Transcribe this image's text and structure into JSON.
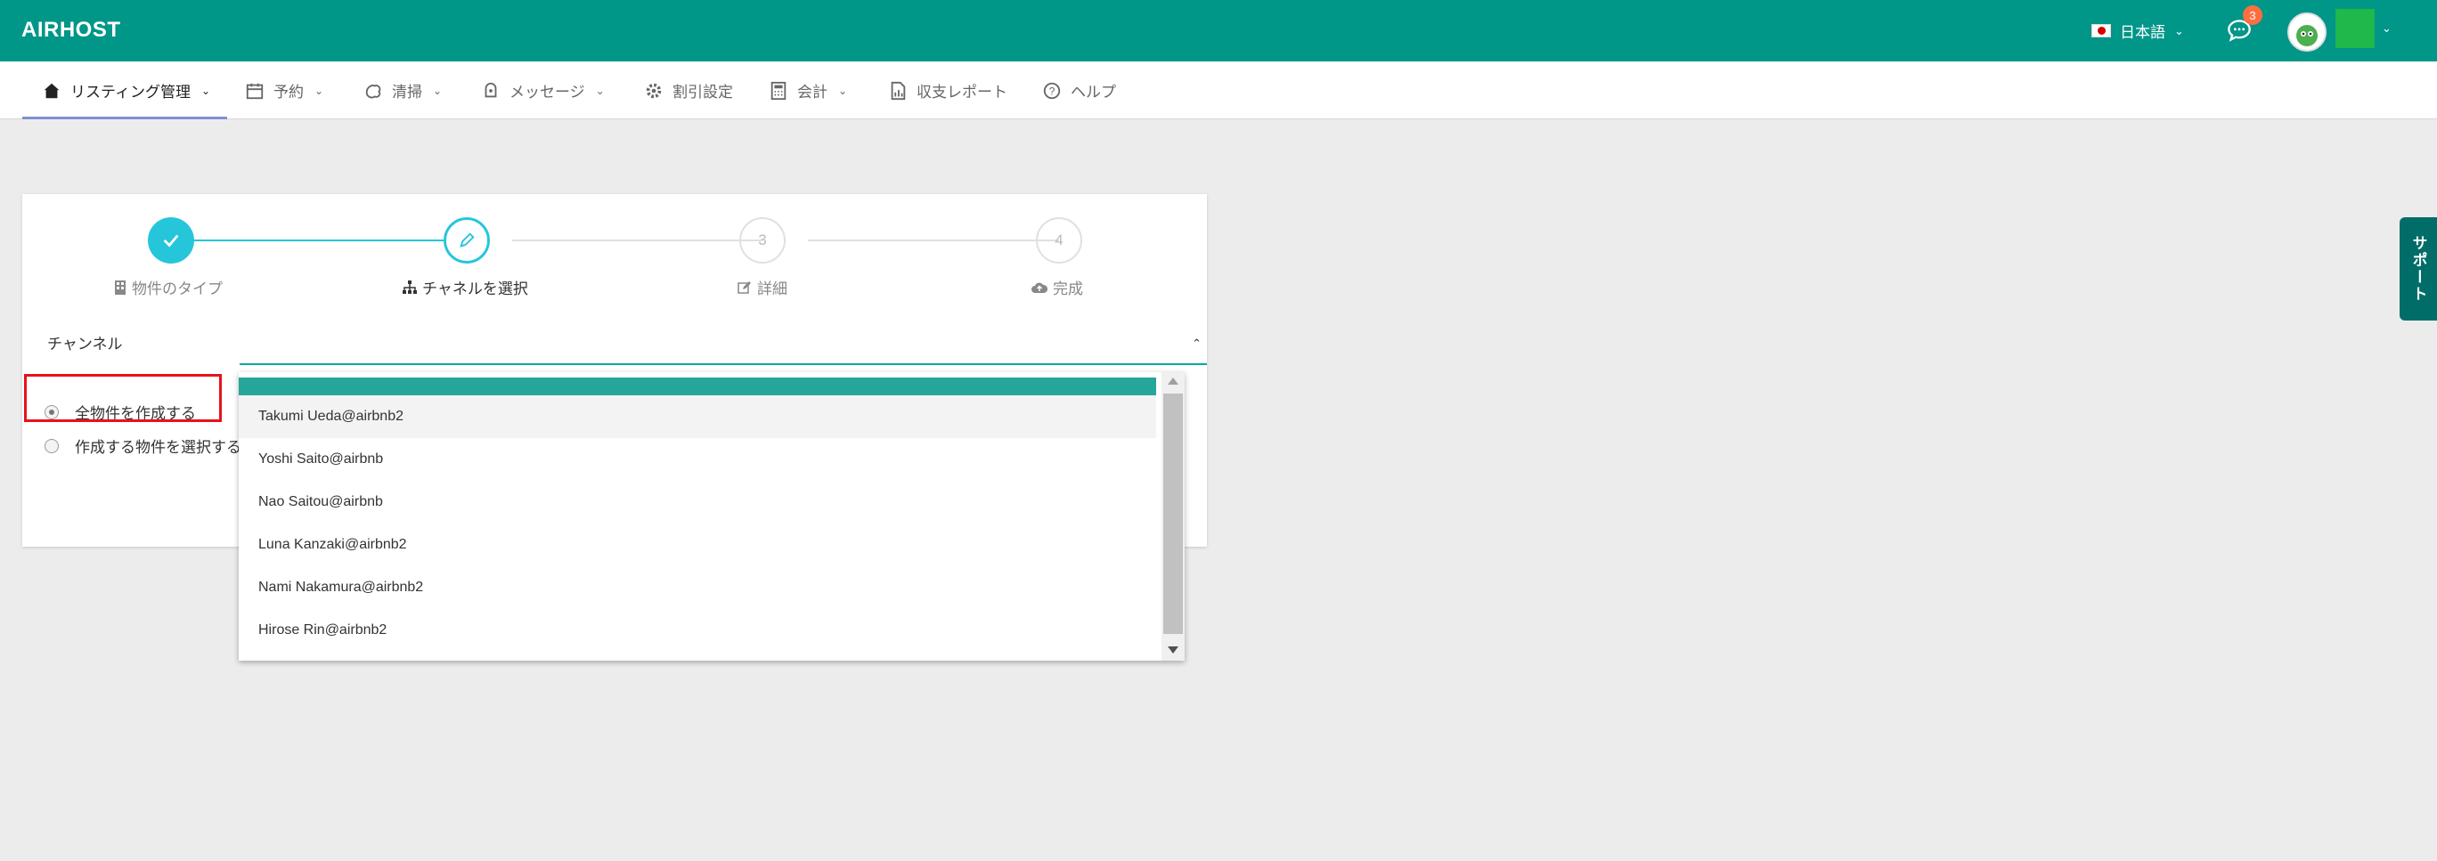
{
  "header": {
    "logo": "AIRHOST",
    "language": "日本語",
    "notification_count": "3"
  },
  "nav": {
    "items": [
      {
        "label": "リスティング管理",
        "icon": "home-icon",
        "has_dropdown": true,
        "active": true
      },
      {
        "label": "予約",
        "icon": "calendar-icon",
        "has_dropdown": true
      },
      {
        "label": "清掃",
        "icon": "cleaning-icon",
        "has_dropdown": true
      },
      {
        "label": "メッセージ",
        "icon": "message-icon",
        "has_dropdown": true
      },
      {
        "label": "割引設定",
        "icon": "gear-icon",
        "has_dropdown": false
      },
      {
        "label": "会計",
        "icon": "calculator-icon",
        "has_dropdown": true
      },
      {
        "label": "収支レポート",
        "icon": "report-icon",
        "has_dropdown": false
      },
      {
        "label": "ヘルプ",
        "icon": "help-icon",
        "has_dropdown": false
      }
    ]
  },
  "steps": [
    {
      "number": "",
      "label": "物件のタイプ",
      "state": "done",
      "icon": "building-icon"
    },
    {
      "number": "",
      "label": "チャネルを選択",
      "state": "current",
      "icon": "sitemap-icon"
    },
    {
      "number": "3",
      "label": "詳細",
      "state": "todo",
      "icon": "edit-icon"
    },
    {
      "number": "4",
      "label": "完成",
      "state": "todo",
      "icon": "cloud-upload-icon"
    }
  ],
  "form": {
    "channel_label": "チャンネル",
    "radio_all": "全物件を作成する",
    "radio_select": "作成する物件を選択する"
  },
  "dropdown": {
    "options": [
      "Takumi Ueda@airbnb2",
      "Yoshi Saito@airbnb",
      "Nao Saitou@airbnb",
      "Luna Kanzaki@airbnb2",
      "Nami Nakamura@airbnb2",
      "Hirose Rin@airbnb2"
    ]
  },
  "support_tab": "サポート",
  "colors": {
    "brand": "#009688",
    "accent": "#26c6da",
    "highlight": "#e8121b"
  }
}
